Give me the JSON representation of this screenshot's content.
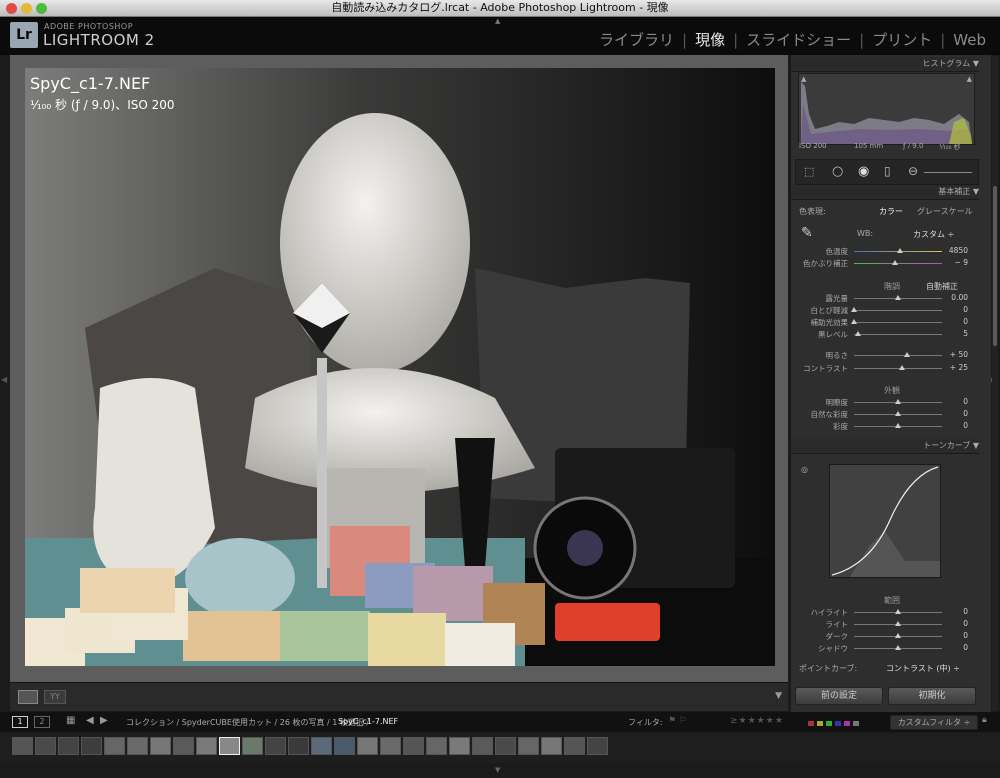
{
  "window": {
    "title": "自動読み込みカタログ.lrcat - Adobe Photoshop Lightroom - 現像"
  },
  "logo": {
    "icon": "Lr",
    "small": "ADOBE PHOTOSHOP",
    "big": "LIGHTROOM 2"
  },
  "modules": [
    "ライブラリ",
    "現像",
    "スライドショー",
    "プリント",
    "Web"
  ],
  "active_module": "現像",
  "photo": {
    "filename": "SpyC_c1-7.NEF",
    "exif": "¹⁄₁₀₀ 秒 (ƒ / 9.0)、ISO 200"
  },
  "panel": {
    "histogram": {
      "title": "ヒストグラム",
      "iso": "ISO 200",
      "focal": "105 mm",
      "aperture": "ƒ / 9.0",
      "shutter": "¹⁄₁₀₀ 秒"
    },
    "basic": {
      "title": "基本補正",
      "treatment_label": "色表現:",
      "treatment_color": "カラー",
      "treatment_gray": "グレースケール",
      "wb_label": "WB:",
      "wb_value": "カスタム ÷",
      "wb_sliders": [
        {
          "label": "色温度",
          "value": "4850",
          "pos": 0.52
        },
        {
          "label": "色かぶり補正",
          "value": "− 9",
          "pos": 0.47
        }
      ],
      "tone_title": "階調",
      "auto_label": "自動補正",
      "tone_sliders": [
        {
          "label": "露光量",
          "value": "0.00",
          "pos": 0.5
        },
        {
          "label": "白とび軽減",
          "value": "0",
          "pos": 0.0
        },
        {
          "label": "補助光効果",
          "value": "0",
          "pos": 0.0
        },
        {
          "label": "黒レベル",
          "value": "5",
          "pos": 0.05
        }
      ],
      "tone_sliders2": [
        {
          "label": "明るさ",
          "value": "+ 50",
          "pos": 0.6
        },
        {
          "label": "コントラスト",
          "value": "+ 25",
          "pos": 0.55
        }
      ],
      "presence_title": "外観",
      "presence_sliders": [
        {
          "label": "明瞭度",
          "value": "0",
          "pos": 0.5
        },
        {
          "label": "自然な彩度",
          "value": "0",
          "pos": 0.5
        },
        {
          "label": "彩度",
          "value": "0",
          "pos": 0.5
        }
      ]
    },
    "tone_curve": {
      "title": "トーンカーブ",
      "region_title": "範囲",
      "sliders": [
        {
          "label": "ハイライト",
          "value": "0",
          "pos": 0.5
        },
        {
          "label": "ライト",
          "value": "0",
          "pos": 0.5
        },
        {
          "label": "ダーク",
          "value": "0",
          "pos": 0.5
        },
        {
          "label": "シャドウ",
          "value": "0",
          "pos": 0.5
        }
      ],
      "point_curve_label": "ポイントカーブ:",
      "point_curve_value": "コントラスト (中) ÷"
    },
    "buttons": {
      "previous": "前の設定",
      "reset": "初期化"
    }
  },
  "filmstrip": {
    "page1": "1",
    "page2": "2",
    "path": "コレクション / SpyderCUBE使用カット / 26 枚の写真 / 1 枚選択 / ",
    "selected": "SpyC_c1-7.NEF",
    "filter_label": "フィルタ:",
    "custom_filter": "カスタムフィルタ ÷"
  },
  "colors": {
    "accent": "#dddddd",
    "panel_bg": "#2e2e2e",
    "photo_frame": "#5d5d5d"
  }
}
